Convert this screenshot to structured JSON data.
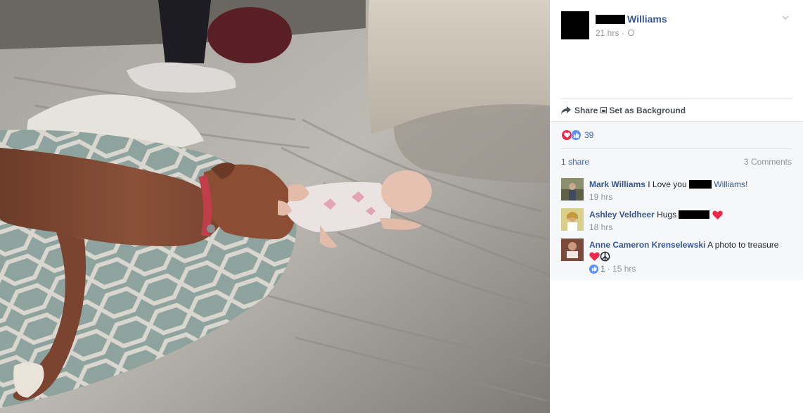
{
  "post": {
    "author_name": "Williams",
    "time": "21 hrs ·",
    "privacy_icon": "globe-icon"
  },
  "actions": {
    "share": "Share",
    "set_background": "Set as Background"
  },
  "reactions": {
    "count": "39",
    "icons": [
      "love-reaction-icon",
      "like-reaction-icon"
    ]
  },
  "stats": {
    "shares": "1 share",
    "comments": "3 Comments"
  },
  "comments": [
    {
      "name": "Mark Williams",
      "text_before": "I Love you",
      "link_after": "Williams!",
      "time": "19 hrs"
    },
    {
      "name": "Ashley Veldheer",
      "text_before": "Hugs",
      "emoji": "heart-emoji",
      "time": "18 hrs"
    },
    {
      "name": "Anne Cameron Krenselewski",
      "text_before": "A photo to treasure",
      "emoji": "heart-peace-emoji",
      "likes": "1",
      "time": "· 15 hrs"
    }
  ],
  "colors": {
    "link": "#365899",
    "meta": "#90949c",
    "love": "#f0284a",
    "like": "#5890ff"
  }
}
